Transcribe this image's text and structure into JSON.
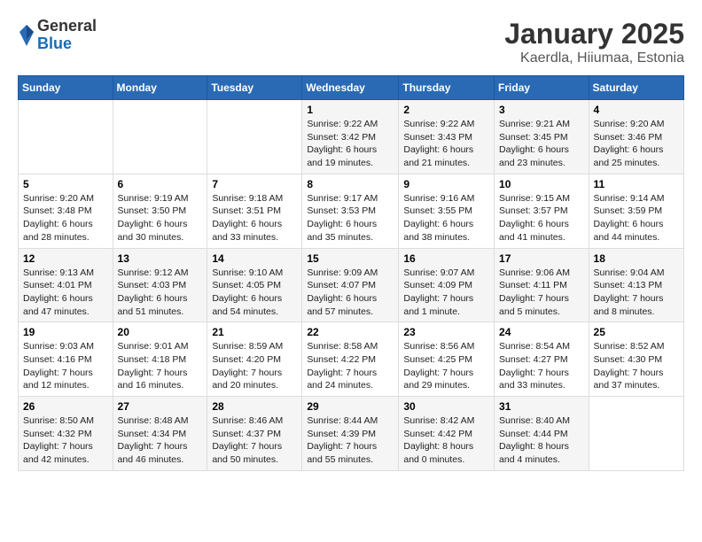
{
  "header": {
    "logo_general": "General",
    "logo_blue": "Blue",
    "title": "January 2025",
    "subtitle": "Kaerdla, Hiiumaa, Estonia"
  },
  "weekdays": [
    "Sunday",
    "Monday",
    "Tuesday",
    "Wednesday",
    "Thursday",
    "Friday",
    "Saturday"
  ],
  "weeks": [
    [
      {
        "day": "",
        "sunrise": "",
        "sunset": "",
        "daylight": ""
      },
      {
        "day": "",
        "sunrise": "",
        "sunset": "",
        "daylight": ""
      },
      {
        "day": "",
        "sunrise": "",
        "sunset": "",
        "daylight": ""
      },
      {
        "day": "1",
        "sunrise": "9:22 AM",
        "sunset": "3:42 PM",
        "daylight": "6 hours and 19 minutes."
      },
      {
        "day": "2",
        "sunrise": "9:22 AM",
        "sunset": "3:43 PM",
        "daylight": "6 hours and 21 minutes."
      },
      {
        "day": "3",
        "sunrise": "9:21 AM",
        "sunset": "3:45 PM",
        "daylight": "6 hours and 23 minutes."
      },
      {
        "day": "4",
        "sunrise": "9:20 AM",
        "sunset": "3:46 PM",
        "daylight": "6 hours and 25 minutes."
      }
    ],
    [
      {
        "day": "5",
        "sunrise": "9:20 AM",
        "sunset": "3:48 PM",
        "daylight": "6 hours and 28 minutes."
      },
      {
        "day": "6",
        "sunrise": "9:19 AM",
        "sunset": "3:50 PM",
        "daylight": "6 hours and 30 minutes."
      },
      {
        "day": "7",
        "sunrise": "9:18 AM",
        "sunset": "3:51 PM",
        "daylight": "6 hours and 33 minutes."
      },
      {
        "day": "8",
        "sunrise": "9:17 AM",
        "sunset": "3:53 PM",
        "daylight": "6 hours and 35 minutes."
      },
      {
        "day": "9",
        "sunrise": "9:16 AM",
        "sunset": "3:55 PM",
        "daylight": "6 hours and 38 minutes."
      },
      {
        "day": "10",
        "sunrise": "9:15 AM",
        "sunset": "3:57 PM",
        "daylight": "6 hours and 41 minutes."
      },
      {
        "day": "11",
        "sunrise": "9:14 AM",
        "sunset": "3:59 PM",
        "daylight": "6 hours and 44 minutes."
      }
    ],
    [
      {
        "day": "12",
        "sunrise": "9:13 AM",
        "sunset": "4:01 PM",
        "daylight": "6 hours and 47 minutes."
      },
      {
        "day": "13",
        "sunrise": "9:12 AM",
        "sunset": "4:03 PM",
        "daylight": "6 hours and 51 minutes."
      },
      {
        "day": "14",
        "sunrise": "9:10 AM",
        "sunset": "4:05 PM",
        "daylight": "6 hours and 54 minutes."
      },
      {
        "day": "15",
        "sunrise": "9:09 AM",
        "sunset": "4:07 PM",
        "daylight": "6 hours and 57 minutes."
      },
      {
        "day": "16",
        "sunrise": "9:07 AM",
        "sunset": "4:09 PM",
        "daylight": "7 hours and 1 minute."
      },
      {
        "day": "17",
        "sunrise": "9:06 AM",
        "sunset": "4:11 PM",
        "daylight": "7 hours and 5 minutes."
      },
      {
        "day": "18",
        "sunrise": "9:04 AM",
        "sunset": "4:13 PM",
        "daylight": "7 hours and 8 minutes."
      }
    ],
    [
      {
        "day": "19",
        "sunrise": "9:03 AM",
        "sunset": "4:16 PM",
        "daylight": "7 hours and 12 minutes."
      },
      {
        "day": "20",
        "sunrise": "9:01 AM",
        "sunset": "4:18 PM",
        "daylight": "7 hours and 16 minutes."
      },
      {
        "day": "21",
        "sunrise": "8:59 AM",
        "sunset": "4:20 PM",
        "daylight": "7 hours and 20 minutes."
      },
      {
        "day": "22",
        "sunrise": "8:58 AM",
        "sunset": "4:22 PM",
        "daylight": "7 hours and 24 minutes."
      },
      {
        "day": "23",
        "sunrise": "8:56 AM",
        "sunset": "4:25 PM",
        "daylight": "7 hours and 29 minutes."
      },
      {
        "day": "24",
        "sunrise": "8:54 AM",
        "sunset": "4:27 PM",
        "daylight": "7 hours and 33 minutes."
      },
      {
        "day": "25",
        "sunrise": "8:52 AM",
        "sunset": "4:30 PM",
        "daylight": "7 hours and 37 minutes."
      }
    ],
    [
      {
        "day": "26",
        "sunrise": "8:50 AM",
        "sunset": "4:32 PM",
        "daylight": "7 hours and 42 minutes."
      },
      {
        "day": "27",
        "sunrise": "8:48 AM",
        "sunset": "4:34 PM",
        "daylight": "7 hours and 46 minutes."
      },
      {
        "day": "28",
        "sunrise": "8:46 AM",
        "sunset": "4:37 PM",
        "daylight": "7 hours and 50 minutes."
      },
      {
        "day": "29",
        "sunrise": "8:44 AM",
        "sunset": "4:39 PM",
        "daylight": "7 hours and 55 minutes."
      },
      {
        "day": "30",
        "sunrise": "8:42 AM",
        "sunset": "4:42 PM",
        "daylight": "8 hours and 0 minutes."
      },
      {
        "day": "31",
        "sunrise": "8:40 AM",
        "sunset": "4:44 PM",
        "daylight": "8 hours and 4 minutes."
      },
      {
        "day": "",
        "sunrise": "",
        "sunset": "",
        "daylight": ""
      }
    ]
  ]
}
